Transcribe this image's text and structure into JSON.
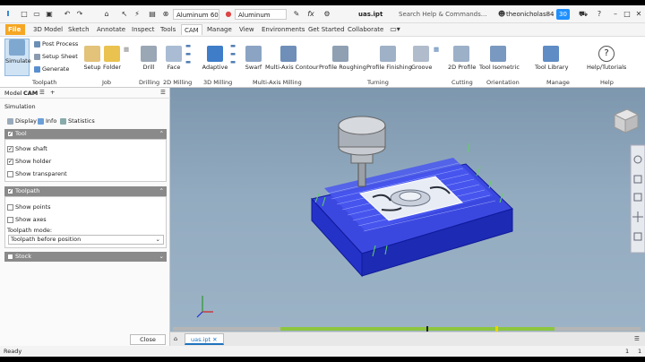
{
  "qat": {
    "material": "Aluminum 60",
    "appearance": "Aluminum",
    "doc_title": "uas.ipt",
    "search_placeholder": "Search Help & Commands...",
    "user": "theonicholas84",
    "trial_badge": "30"
  },
  "tabs": [
    "File",
    "3D Model",
    "Sketch",
    "Annotate",
    "Inspect",
    "Tools",
    "CAM",
    "Manage",
    "View",
    "Environments",
    "Get Started",
    "Collaborate"
  ],
  "ribbon": {
    "toolpath": {
      "simulate": "Simulate",
      "post_process": "Post Process",
      "setup_sheet": "Setup Sheet",
      "generate": "Generate",
      "panel": "Toolpath"
    },
    "job": {
      "setup": "Setup",
      "folder": "Folder",
      "panel": "Job"
    },
    "drilling": {
      "drill": "Drill",
      "panel": "Drilling"
    },
    "milling2d": {
      "face": "Face",
      "panel": "2D Milling"
    },
    "milling3d": {
      "adaptive": "Adaptive",
      "panel": "3D Milling"
    },
    "multiaxis": {
      "swarf": "Swarf",
      "multi_axis_contour": "Multi-Axis Contour",
      "panel": "Multi-Axis Milling"
    },
    "turning": {
      "profile_roughing": "Profile Roughing",
      "profile_finishing": "Profile Finishing",
      "groove": "Groove",
      "panel": "Turning"
    },
    "cutting": {
      "profile_2d": "2D Profile",
      "panel": "Cutting"
    },
    "orientation": {
      "tool_isometric": "Tool Isometric",
      "panel": "Orientation"
    },
    "manage": {
      "tool_library": "Tool Library",
      "panel": "Manage"
    },
    "help": {
      "help_tutorials": "Help/Tutorials",
      "panel": "Help"
    }
  },
  "left": {
    "tab_model": "Model",
    "tab_cam": "CAM",
    "title": "Simulation",
    "subtabs": [
      "Display",
      "Info",
      "Statistics"
    ],
    "tool": {
      "label": "Tool",
      "show_shaft": "Show shaft",
      "show_holder": "Show holder",
      "show_transparent": "Show transparent",
      "shaft_checked": true,
      "holder_checked": true,
      "transparent_checked": false
    },
    "toolpath": {
      "label": "Toolpath",
      "show_points": "Show points",
      "show_axes": "Show axes",
      "mode_label": "Toolpath mode:",
      "mode_value": "Toolpath before position"
    },
    "stock": {
      "label": "Stock"
    },
    "close": "Close"
  },
  "timeline": {
    "progress": 0.69
  },
  "doc_tab": "uas.ipt",
  "status": {
    "text": "Ready",
    "n1": "1",
    "n2": "1"
  },
  "colors": {
    "accent": "#f5a623",
    "toolpath_blue": "#1a2bd6",
    "timeline_green": "#8dc63f",
    "viewcube": "#d9d9d9"
  }
}
